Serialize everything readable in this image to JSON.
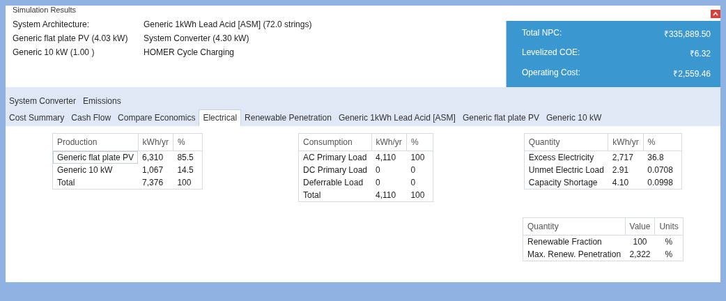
{
  "window": {
    "title": "Simulation Results"
  },
  "architecture": [
    [
      "System Architecture:",
      "Generic 1kWh Lead Acid [ASM] (72.0 strings)"
    ],
    [
      "Generic flat plate PV (4.03 kW)",
      "System Converter (4.30 kW)"
    ],
    [
      "Generic 10 kW (1.00 )",
      "HOMER Cycle Charging"
    ]
  ],
  "summary": [
    {
      "label": "Total NPC:",
      "value": "₹335,889.50"
    },
    {
      "label": "Levelized COE:",
      "value": "₹6.32"
    },
    {
      "label": "Operating Cost:",
      "value": "₹2,559.46"
    }
  ],
  "tab_rows": [
    [
      {
        "label": "System Converter",
        "selected": false
      },
      {
        "label": "Emissions",
        "selected": false
      }
    ],
    [
      {
        "label": "Cost Summary",
        "selected": false
      },
      {
        "label": "Cash Flow",
        "selected": false
      },
      {
        "label": "Compare Economics",
        "selected": false
      },
      {
        "label": "Electrical",
        "selected": true
      },
      {
        "label": "Renewable Penetration",
        "selected": false
      },
      {
        "label": "Generic 1kWh Lead Acid [ASM]",
        "selected": false
      },
      {
        "label": "Generic flat plate PV",
        "selected": false
      },
      {
        "label": "Generic 10 kW",
        "selected": false
      }
    ]
  ],
  "tables": [
    {
      "columns": [
        "Production",
        "kWh/yr",
        "%"
      ],
      "rows": [
        {
          "cells": [
            "Generic flat plate PV",
            "6,310",
            "85.5"
          ],
          "selected": true
        },
        {
          "cells": [
            "Generic 10 kW",
            "1,067",
            "14.5"
          ],
          "selected": false
        },
        {
          "cells": [
            "Total",
            "7,376",
            "100"
          ],
          "selected": false
        }
      ]
    },
    {
      "columns": [
        "Consumption",
        "kWh/yr",
        "%"
      ],
      "rows": [
        {
          "cells": [
            "AC Primary Load",
            "4,110",
            "100"
          ],
          "selected": false
        },
        {
          "cells": [
            "DC Primary Load",
            "0",
            "0"
          ],
          "selected": false
        },
        {
          "cells": [
            "Deferrable Load",
            "0",
            "0"
          ],
          "selected": false
        },
        {
          "cells": [
            "Total",
            "4,110",
            "100"
          ],
          "selected": false
        }
      ]
    },
    {
      "columns": [
        "Quantity",
        "kWh/yr",
        "%"
      ],
      "rows": [
        {
          "cells": [
            "Excess Electricity",
            "2,717",
            "36.8"
          ],
          "selected": false
        },
        {
          "cells": [
            "Unmet Electric Load",
            "2.91",
            "0.0708"
          ],
          "selected": false
        },
        {
          "cells": [
            "Capacity Shortage",
            "4.10",
            "0.0998"
          ],
          "selected": false
        }
      ]
    },
    {
      "columns": [
        "Quantity",
        "Value",
        "Units"
      ],
      "rows": [
        {
          "cells": [
            "Renewable Fraction",
            "100",
            "%"
          ],
          "selected": false
        },
        {
          "cells": [
            "Max. Renew. Penetration",
            "2,322",
            "%"
          ],
          "selected": false
        }
      ]
    }
  ]
}
